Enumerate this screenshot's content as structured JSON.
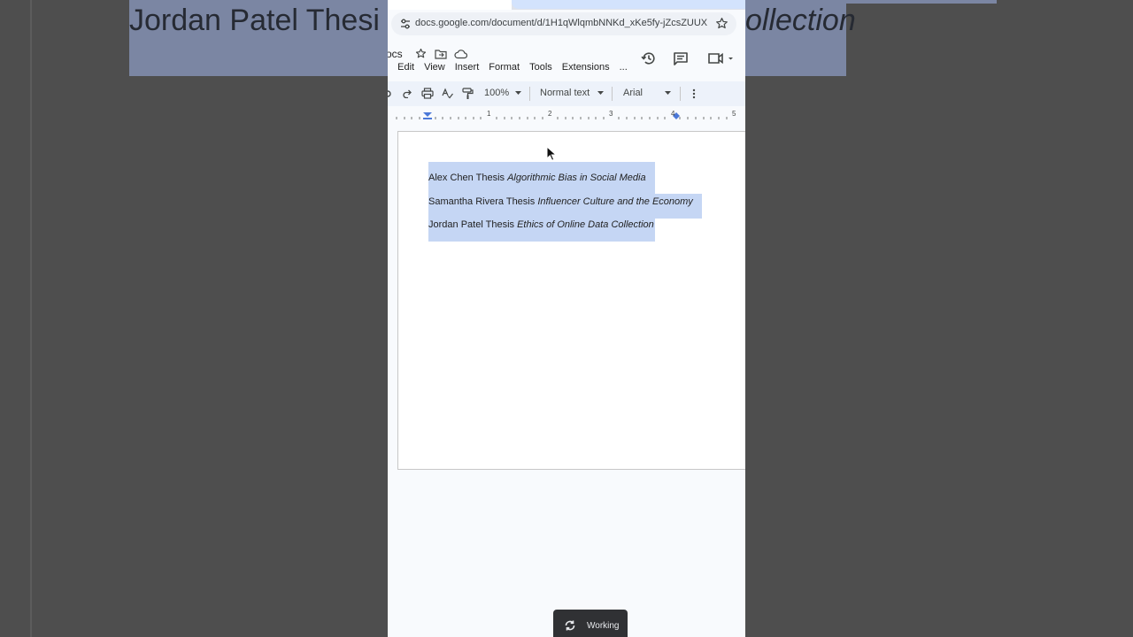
{
  "background": {
    "zoomed_left_text": "Jordan Patel Thesi",
    "zoomed_right_text": "ollection"
  },
  "browser": {
    "url": "docs.google.com/document/d/1H1qWlqmbNNKd_xKe5fy-jZcsZUUXszS..."
  },
  "docs": {
    "title_fragment": "ocs",
    "menu": [
      "e",
      "Edit",
      "View",
      "Insert",
      "Format",
      "Tools",
      "Extensions",
      "..."
    ]
  },
  "toolbar": {
    "zoom": "100%",
    "style": "Normal text",
    "font": "Arial"
  },
  "ruler": {
    "marks": [
      "1",
      "2",
      "3",
      "4",
      "5"
    ]
  },
  "document": {
    "lines": [
      {
        "plain": "Alex Chen  Thesis ",
        "italic": "Algorithmic Bias in Social Media"
      },
      {
        "plain": "Samantha Rivera  Thesis ",
        "italic": "Influencer Culture and the Economy"
      },
      {
        "plain": "Jordan Patel Thesis ",
        "italic": "Ethics of Online Data Collection"
      }
    ]
  },
  "status": {
    "toast": "Working"
  },
  "colors": {
    "selection": "#c5d6f4",
    "toolbar": "#edf2fa",
    "backdrop": "#4e4e4e"
  }
}
